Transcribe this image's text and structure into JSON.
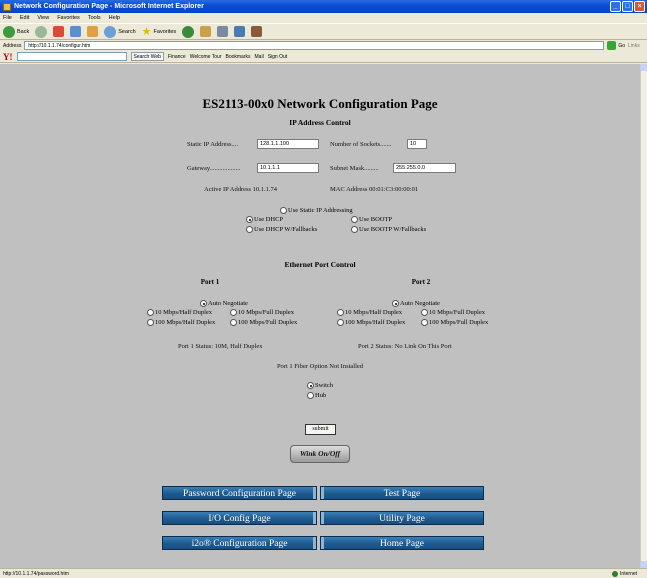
{
  "window": {
    "title": "Network Configuration Page - Microsoft Internet Explorer"
  },
  "menu": [
    "File",
    "Edit",
    "View",
    "Favorites",
    "Tools",
    "Help"
  ],
  "toolbar": {
    "back": "Back",
    "search": "Search",
    "favorites": "Favorites"
  },
  "address": {
    "label": "Address",
    "url": "http://10.1.1.74/configur.htm",
    "go": "Go",
    "links": "Links"
  },
  "yahoo": {
    "logo": "Y!",
    "search_web": "Search Web",
    "finance": "Finance",
    "welcome": "Welcome Tour",
    "bookmarks": "Bookmarks",
    "mail": "Mail",
    "signout": "Sign Out"
  },
  "page": {
    "title": "ES2113-00x0 Network Configuration Page",
    "ip_section": "IP Address Control",
    "static_ip_label": "Static IP Address....",
    "static_ip_value": "128.1.1.100",
    "sockets_label": "Number of Sockets.......",
    "sockets_value": "10",
    "gateway_label": "Gateway...................",
    "gateway_value": "10.1.1.1",
    "subnet_label": "Subnet Mask.........",
    "subnet_value": "255.255.0.0",
    "active_ip": "Active IP Address    10.1.1.74",
    "mac": "MAC Address   00:01:C3:00:00:01",
    "ip_modes": {
      "static": "Use Static IP Addressing",
      "dhcp": "Use DHCP",
      "bootp": "Use BOOTP",
      "dhcp_fb": "Use DHCP W/Fallbacks",
      "bootp_fb": "Use BOOTP W/Fallbacks",
      "selected": "dhcp"
    },
    "eth_section": "Ethernet Port Control",
    "port1": {
      "title": "Port 1",
      "auto": "Auto Negotiate",
      "h10": "10 Mbps/Half Duplex",
      "f10": "10 Mbps/Full Duplex",
      "h100": "100 Mbps/Half Duplex",
      "f100": "100 Mbps/Full Duplex",
      "status": "Port 1 Status: 10M, Half Duplex"
    },
    "port2": {
      "title": "Port 2",
      "auto": "Auto Negotiate",
      "h10": "10 Mbps/Half Duplex",
      "f10": "10 Mbps/Full Duplex",
      "h100": "100 Mbps/Half Duplex",
      "f100": "100 Mbps/Full Duplex",
      "status": "Port 2 Status: No Link On This Port"
    },
    "fiber": "Port 1 Fiber Option Not Installed",
    "mode_switch": "Switch",
    "mode_hub": "Hub",
    "submit": "submit",
    "wink": "Wink On/Off",
    "nav": {
      "password": "Password Configuration Page",
      "test": "Test Page",
      "io": "I/O Config Page",
      "utility": "Utility Page",
      "i2o": "i2o® Configuration Page",
      "home": "Home Page"
    }
  },
  "status": {
    "url": "http://10.1.1.74/password.htm",
    "zone": "Internet"
  },
  "colors": {
    "page_bg": "#c0c0c0",
    "nav_button": "#1e5a8e",
    "titlebar": "#0a4fd6"
  }
}
